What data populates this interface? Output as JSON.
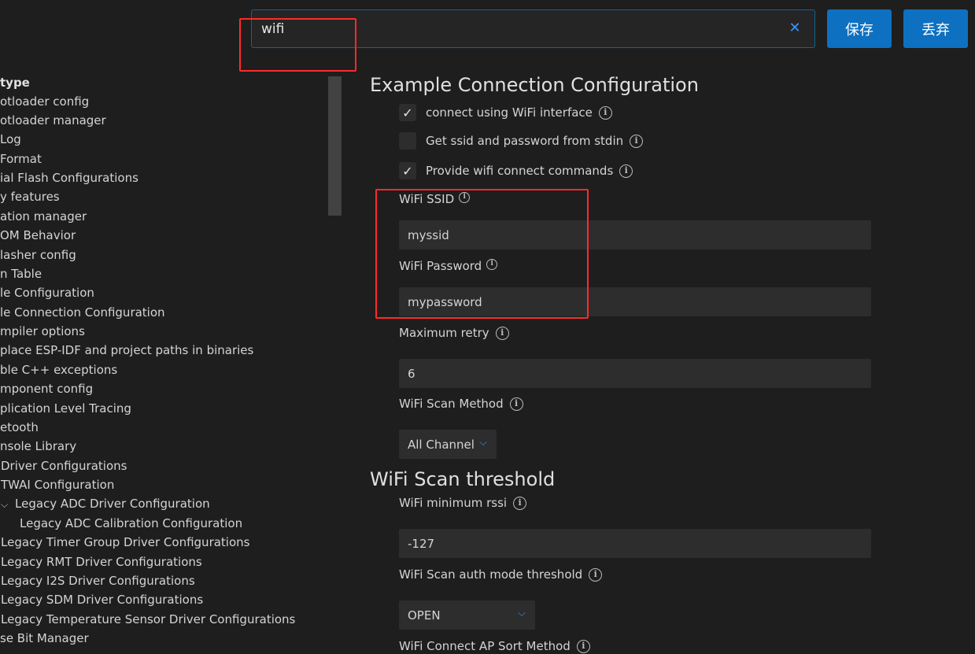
{
  "search": {
    "value": "wifi",
    "clear_icon": "close-icon"
  },
  "buttons": {
    "save": "保存",
    "discard": "丢弃"
  },
  "tree": [
    {
      "label": "type",
      "bold": true
    },
    {
      "label": "otloader config"
    },
    {
      "label": "otloader manager"
    },
    {
      "label": "Log"
    },
    {
      "label": "Format"
    },
    {
      "label": "ial Flash Configurations"
    },
    {
      "label": "y features"
    },
    {
      "label": "ation manager"
    },
    {
      "label": "OM Behavior"
    },
    {
      "label": "lasher config"
    },
    {
      "label": "n Table"
    },
    {
      "label": "le Configuration"
    },
    {
      "label": "le Connection Configuration"
    },
    {
      "label": "mpiler options"
    },
    {
      "label": "place ESP-IDF and project paths in binaries"
    },
    {
      "label": "ble C++ exceptions"
    },
    {
      "label": "mponent config"
    },
    {
      "label": "plication Level Tracing"
    },
    {
      "label": "etooth"
    },
    {
      "label": "nsole Library"
    },
    {
      "label": "Driver Configurations"
    },
    {
      "label": "TWAI Configuration"
    },
    {
      "label": "Legacy ADC Driver Configuration",
      "chevron": true
    },
    {
      "label": "Legacy ADC Calibration Configuration",
      "indent": true
    },
    {
      "label": "Legacy Timer Group Driver Configurations"
    },
    {
      "label": "Legacy RMT Driver Configurations"
    },
    {
      "label": "Legacy I2S Driver Configurations"
    },
    {
      "label": "Legacy SDM Driver Configurations"
    },
    {
      "label": "Legacy Temperature Sensor Driver Configurations"
    },
    {
      "label": "se Bit Manager"
    }
  ],
  "section1": {
    "title": "Example Connection Configuration",
    "checks": [
      {
        "label": "connect using WiFi interface",
        "checked": true
      },
      {
        "label": "Get ssid and password from stdin",
        "checked": false
      },
      {
        "label": "Provide wifi connect commands",
        "checked": true
      }
    ],
    "ssid_label": "WiFi SSID",
    "ssid_value": "myssid",
    "password_label": "WiFi Password",
    "password_value": "mypassword",
    "retry_label": "Maximum retry",
    "retry_value": "6",
    "scan_method_label": "WiFi Scan Method",
    "scan_method_value": "All Channel"
  },
  "section2": {
    "title": "WiFi Scan threshold",
    "rssi_label": "WiFi minimum rssi",
    "rssi_value": "-127",
    "auth_label": "WiFi Scan auth mode threshold",
    "auth_value": "OPEN",
    "sort_label": "WiFi Connect AP Sort Method"
  },
  "colors": {
    "accent": "#0e70c0",
    "annotation": "#ff2a2a",
    "background": "#1e1e1e"
  }
}
